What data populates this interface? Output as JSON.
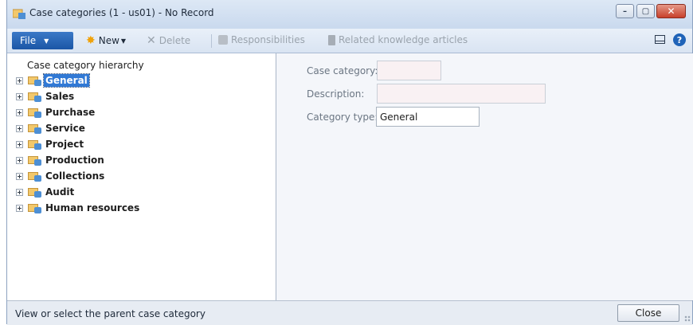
{
  "window": {
    "title": "Case categories (1 - us01) - No Record",
    "controls": {
      "minimize": "–",
      "maximize": "▢",
      "close": "✕"
    }
  },
  "toolbar": {
    "file_label": "File",
    "new_label": "New",
    "delete_label": "Delete",
    "responsibilities_label": "Responsibilities",
    "related_label": "Related knowledge articles",
    "help_glyph": "?"
  },
  "tree": {
    "header": "Case category hierarchy",
    "items": [
      {
        "label": "General"
      },
      {
        "label": "Sales"
      },
      {
        "label": "Purchase"
      },
      {
        "label": "Service"
      },
      {
        "label": "Project"
      },
      {
        "label": "Production"
      },
      {
        "label": "Collections"
      },
      {
        "label": "Audit"
      },
      {
        "label": "Human resources"
      }
    ],
    "selected": "General"
  },
  "form": {
    "case_category_label": "Case category:",
    "case_category_value": "",
    "description_label": "Description:",
    "description_value": "",
    "category_type_label": "Category type:",
    "category_type_value": "General"
  },
  "status": {
    "text": "View or select the parent case category",
    "close_label": "Close"
  },
  "colors": {
    "accent": "#1f63b8",
    "selection": "#3179d5",
    "close_button": "#c7402b"
  }
}
